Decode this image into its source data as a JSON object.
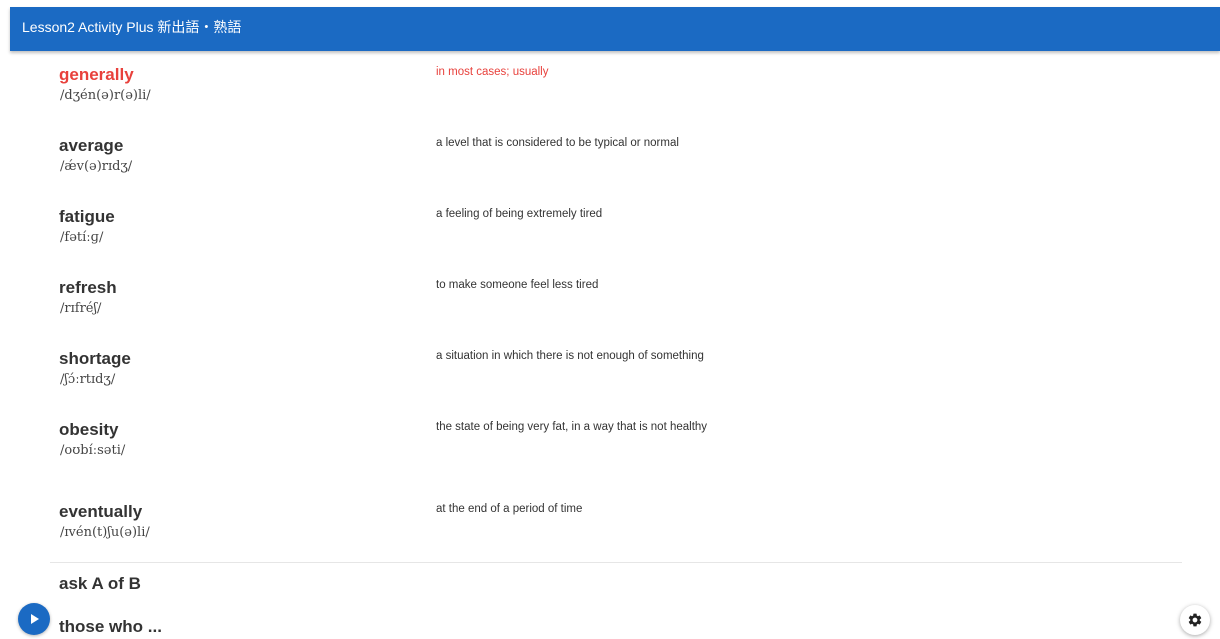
{
  "header": {
    "title": "Lesson2 Activity Plus 新出語・熟語"
  },
  "colors": {
    "app_bar": "#1b6ac3",
    "highlight": "#e8413c",
    "text": "#333333"
  },
  "entries": [
    {
      "word": "generally",
      "pronunciation": "/dʒén(ə)r(ə)li/",
      "definition": "in most cases; usually",
      "highlighted": true
    },
    {
      "word": "average",
      "pronunciation": "/ǽv(ə)rɪdʒ/",
      "definition": "a level that is considered to be typical or normal",
      "highlighted": false
    },
    {
      "word": "fatigue",
      "pronunciation": "/fətíːɡ/",
      "definition": "a feeling of being extremely tired",
      "highlighted": false
    },
    {
      "word": "refresh",
      "pronunciation": "/rɪfréʃ/",
      "definition": "to make someone feel less tired",
      "highlighted": false
    },
    {
      "word": "shortage",
      "pronunciation": "/ʃɔ́ːrtɪdʒ/",
      "definition": "a situation in which there is not enough of something",
      "highlighted": false
    },
    {
      "word": "obesity",
      "pronunciation": "/oʊbíːsəti/",
      "definition": "the state of being very fat, in a way that is not healthy",
      "highlighted": false
    },
    {
      "word": "eventually",
      "pronunciation": "/ɪvén(t)ʃu(ə)li/",
      "definition": "at the end of a period of time",
      "highlighted": false
    }
  ],
  "phrases": [
    {
      "text": "ask A of B"
    },
    {
      "text": "those who ..."
    }
  ],
  "icons": {
    "play": "play-icon",
    "settings": "gear-icon"
  }
}
